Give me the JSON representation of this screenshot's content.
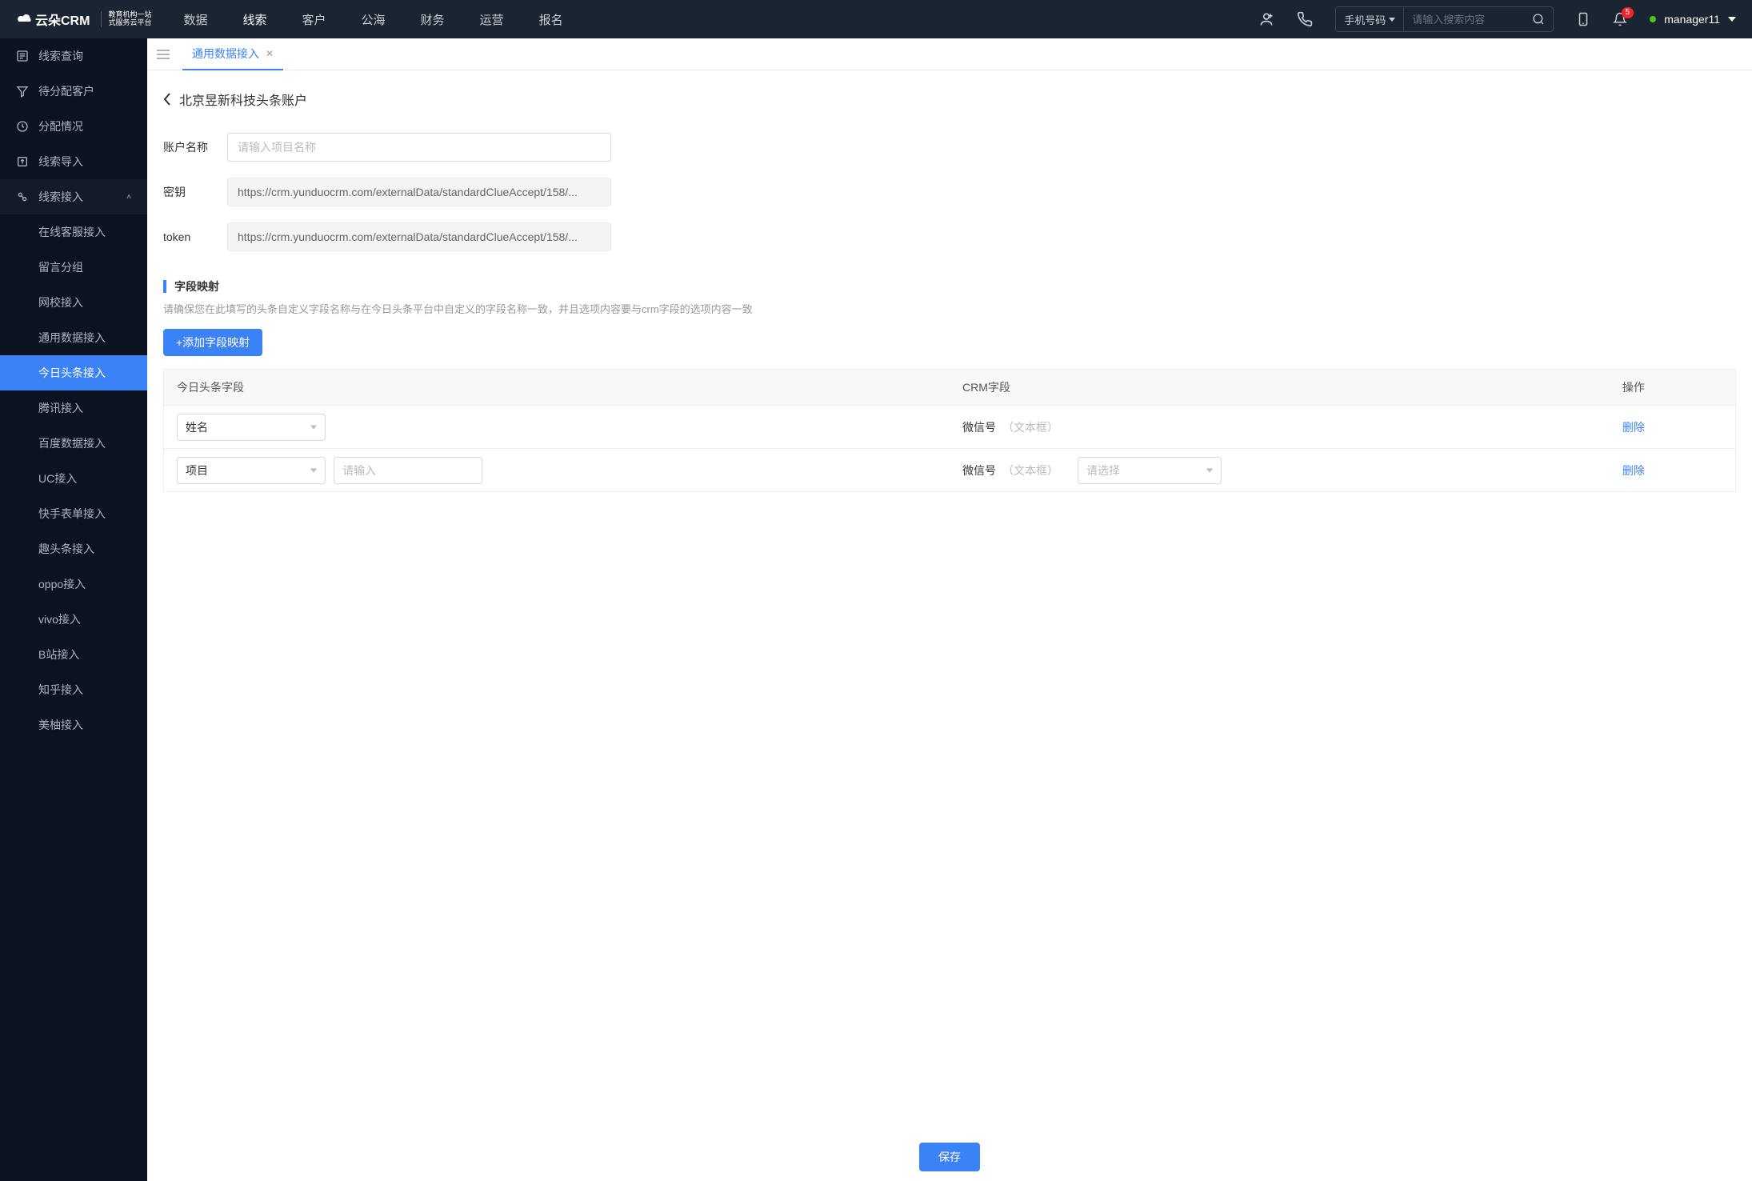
{
  "brand": {
    "name": "云朵CRM",
    "sub1": "教育机构一站",
    "sub2": "式服务云平台",
    "url": "www.yunduocrm.com"
  },
  "nav": {
    "items": [
      "数据",
      "线索",
      "客户",
      "公海",
      "财务",
      "运营",
      "报名"
    ],
    "active": "线索"
  },
  "search": {
    "type": "手机号码",
    "placeholder": "请输入搜索内容"
  },
  "notifications": {
    "count": "5"
  },
  "user": {
    "name": "manager11"
  },
  "sidebar": {
    "items": [
      {
        "label": "线索查询",
        "icon": "list"
      },
      {
        "label": "待分配客户",
        "icon": "filter"
      },
      {
        "label": "分配情况",
        "icon": "clock"
      },
      {
        "label": "线索导入",
        "icon": "export"
      },
      {
        "label": "线索接入",
        "icon": "plug",
        "expanded": true,
        "children": [
          "在线客服接入",
          "留言分组",
          "网校接入",
          "通用数据接入",
          "今日头条接入",
          "腾讯接入",
          "百度数据接入",
          "UC接入",
          "快手表单接入",
          "趣头条接入",
          "oppo接入",
          "vivo接入",
          "B站接入",
          "知乎接入",
          "美柚接入"
        ],
        "activeChild": "今日头条接入"
      }
    ]
  },
  "tab": {
    "label": "通用数据接入"
  },
  "page": {
    "title": "北京昱新科技头条账户",
    "accountNameLabel": "账户名称",
    "accountNamePlaceholder": "请输入项目名称",
    "secretLabel": "密钥",
    "secretValue": "https://crm.yunduocrm.com/externalData/standardClueAccept/158/...",
    "tokenLabel": "token",
    "tokenValue": "https://crm.yunduocrm.com/externalData/standardClueAccept/158/..."
  },
  "mapping": {
    "title": "字段映射",
    "desc": "请确保您在此填写的头条自定义字段名称与在今日头条平台中自定义的字段名称一致，并且选项内容要与crm字段的选项内容一致",
    "addBtn": "+添加字段映射",
    "cols": {
      "a": "今日头条字段",
      "b": "CRM字段",
      "c": "操作"
    },
    "rows": [
      {
        "fieldSelect": "姓名",
        "extraInput": null,
        "crmLabel": "微信号",
        "crmHint": "（文本框）",
        "crmSelect": null,
        "action": "删除"
      },
      {
        "fieldSelect": "项目",
        "extraInputPlaceholder": "请输入",
        "crmLabel": "微信号",
        "crmHint": "（文本框）",
        "crmSelectPlaceholder": "请选择",
        "action": "删除"
      }
    ]
  },
  "saveBtn": "保存"
}
